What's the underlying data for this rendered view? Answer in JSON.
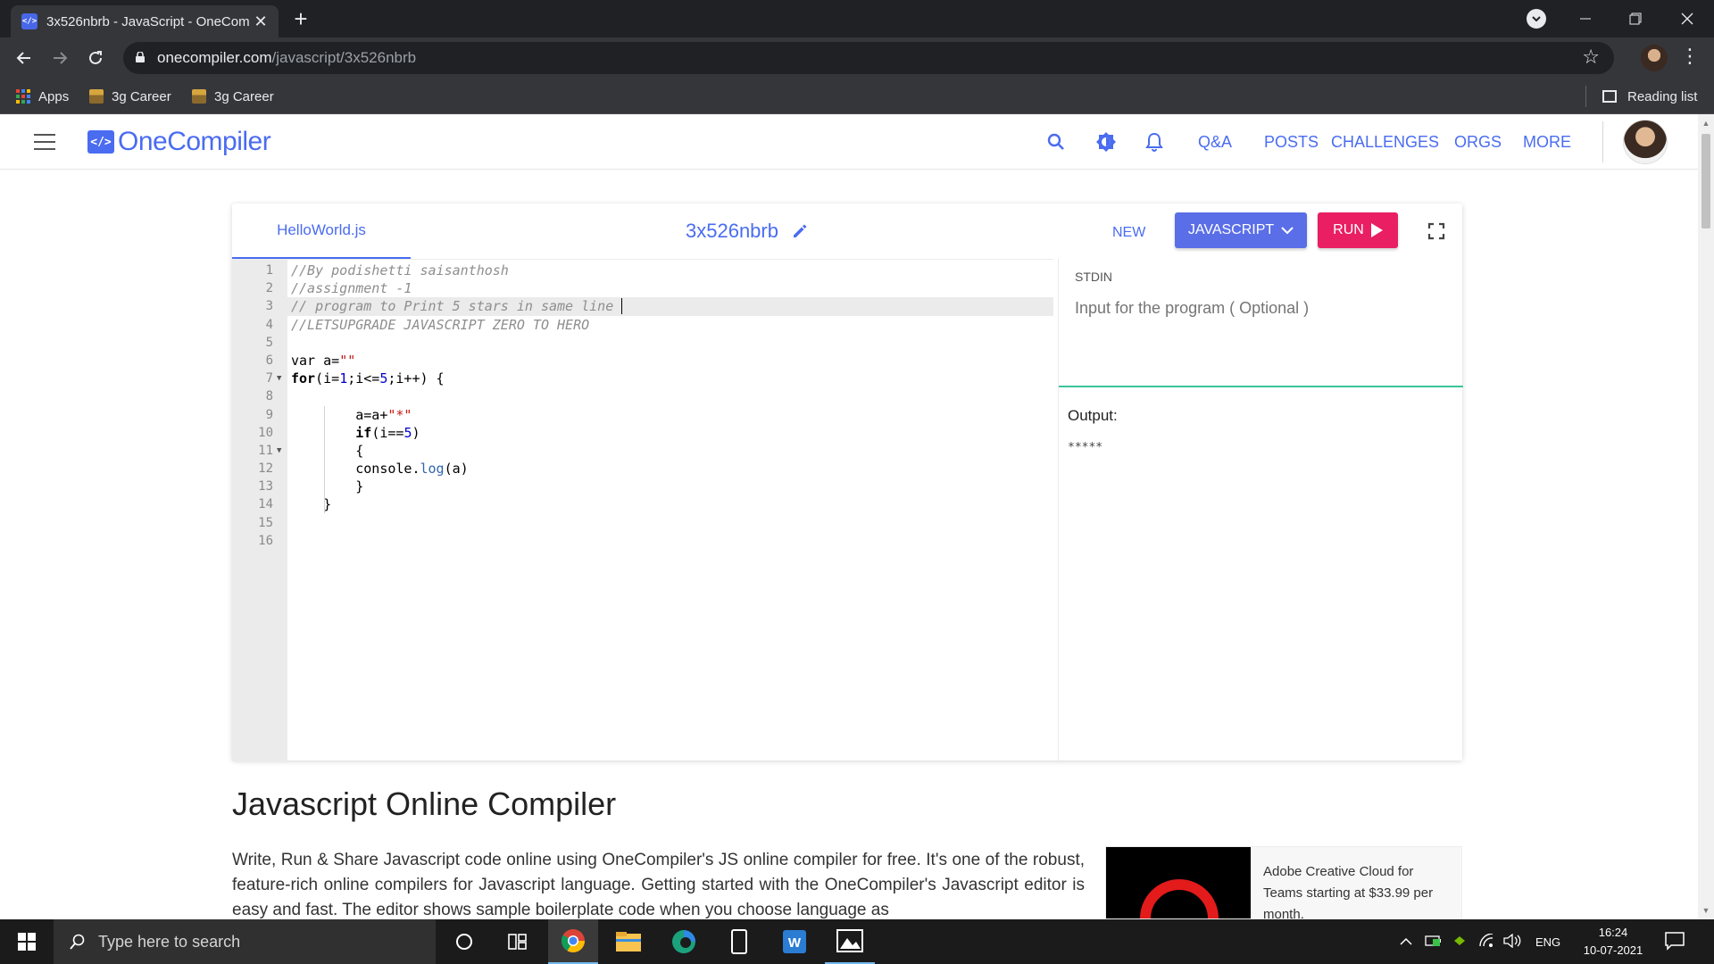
{
  "browser": {
    "tab_title": "3x526nbrb - JavaScript - OneCom",
    "favicon_text": "</>",
    "url_host": "onecompiler.com",
    "url_path": "/javascript/3x526nbrb",
    "bookmarks": [
      {
        "label": "Apps",
        "icon": "apps-grid-icon"
      },
      {
        "label": "3g Career",
        "icon": "bookmark-favicon"
      },
      {
        "label": "3g Career",
        "icon": "bookmark-favicon"
      }
    ],
    "reading_list": "Reading list"
  },
  "site": {
    "logo_mark": "</>",
    "logo_text": "OneCompiler",
    "nav": [
      {
        "label": "Q&A"
      },
      {
        "label": "POSTS"
      },
      {
        "label": "CHALLENGES"
      },
      {
        "label": "ORGS"
      },
      {
        "label": "MORE"
      }
    ],
    "accent_color": "#4a6cf0"
  },
  "editor": {
    "file_tab": "HelloWorld.js",
    "code_id": "3x526nbrb",
    "new_label": "NEW",
    "language_label": "JAVASCRIPT",
    "run_label": "RUN",
    "line_numbers": [
      "1",
      "2",
      "3",
      "4",
      "5",
      "6",
      "7",
      "8",
      "9",
      "10",
      "11",
      "12",
      "13",
      "14",
      "15",
      "16"
    ],
    "code": [
      "//By podishetti saisanthosh",
      "//assignment -1",
      "// program to Print 5 stars in same line ",
      "//LETSUPGRADE JAVASCRIPT ZERO TO HERO",
      "",
      "var a=\"\"",
      "for(i=1;i<=5;i++) {",
      "",
      "        a=a+\"*\"",
      "        if(i==5)",
      "        {",
      "        console.log(a)",
      "        }",
      "    }",
      "",
      ""
    ],
    "stdin_label": "STDIN",
    "stdin_placeholder": "Input for the program ( Optional )",
    "output_label": "Output:",
    "output_value": "*****"
  },
  "article": {
    "title": "Javascript Online Compiler",
    "body": "Write, Run & Share Javascript code online using OneCompiler's JS online compiler for free. It's one of the robust, feature-rich online compilers for Javascript language. Getting started with the OneCompiler's Javascript editor is easy and fast. The editor shows sample boilerplate code when you choose language as"
  },
  "ad": {
    "text": "Adobe Creative Cloud for Teams starting at $33.99 per month."
  },
  "taskbar": {
    "search_placeholder": "Type here to search",
    "language": "ENG",
    "time": "16:24",
    "date": "10-07-2021"
  }
}
